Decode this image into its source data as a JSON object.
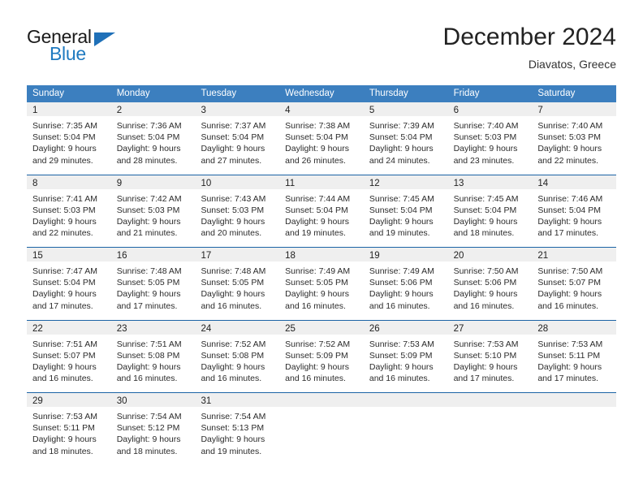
{
  "brand": {
    "name_part1": "General",
    "name_part2": "Blue",
    "triangle_color": "#1f70b8",
    "blue_color": "#1f7ac0"
  },
  "header": {
    "month_title": "December 2024",
    "location": "Diavatos, Greece"
  },
  "colors": {
    "header_band": "#3c7fbf",
    "row_divider": "#1b63a5",
    "day_number_band": "#efefef",
    "text": "#2b2b2b"
  },
  "weekdays": [
    "Sunday",
    "Monday",
    "Tuesday",
    "Wednesday",
    "Thursday",
    "Friday",
    "Saturday"
  ],
  "weeks": [
    [
      {
        "day": "1",
        "sunrise": "Sunrise: 7:35 AM",
        "sunset": "Sunset: 5:04 PM",
        "daylight1": "Daylight: 9 hours",
        "daylight2": "and 29 minutes."
      },
      {
        "day": "2",
        "sunrise": "Sunrise: 7:36 AM",
        "sunset": "Sunset: 5:04 PM",
        "daylight1": "Daylight: 9 hours",
        "daylight2": "and 28 minutes."
      },
      {
        "day": "3",
        "sunrise": "Sunrise: 7:37 AM",
        "sunset": "Sunset: 5:04 PM",
        "daylight1": "Daylight: 9 hours",
        "daylight2": "and 27 minutes."
      },
      {
        "day": "4",
        "sunrise": "Sunrise: 7:38 AM",
        "sunset": "Sunset: 5:04 PM",
        "daylight1": "Daylight: 9 hours",
        "daylight2": "and 26 minutes."
      },
      {
        "day": "5",
        "sunrise": "Sunrise: 7:39 AM",
        "sunset": "Sunset: 5:04 PM",
        "daylight1": "Daylight: 9 hours",
        "daylight2": "and 24 minutes."
      },
      {
        "day": "6",
        "sunrise": "Sunrise: 7:40 AM",
        "sunset": "Sunset: 5:03 PM",
        "daylight1": "Daylight: 9 hours",
        "daylight2": "and 23 minutes."
      },
      {
        "day": "7",
        "sunrise": "Sunrise: 7:40 AM",
        "sunset": "Sunset: 5:03 PM",
        "daylight1": "Daylight: 9 hours",
        "daylight2": "and 22 minutes."
      }
    ],
    [
      {
        "day": "8",
        "sunrise": "Sunrise: 7:41 AM",
        "sunset": "Sunset: 5:03 PM",
        "daylight1": "Daylight: 9 hours",
        "daylight2": "and 22 minutes."
      },
      {
        "day": "9",
        "sunrise": "Sunrise: 7:42 AM",
        "sunset": "Sunset: 5:03 PM",
        "daylight1": "Daylight: 9 hours",
        "daylight2": "and 21 minutes."
      },
      {
        "day": "10",
        "sunrise": "Sunrise: 7:43 AM",
        "sunset": "Sunset: 5:03 PM",
        "daylight1": "Daylight: 9 hours",
        "daylight2": "and 20 minutes."
      },
      {
        "day": "11",
        "sunrise": "Sunrise: 7:44 AM",
        "sunset": "Sunset: 5:04 PM",
        "daylight1": "Daylight: 9 hours",
        "daylight2": "and 19 minutes."
      },
      {
        "day": "12",
        "sunrise": "Sunrise: 7:45 AM",
        "sunset": "Sunset: 5:04 PM",
        "daylight1": "Daylight: 9 hours",
        "daylight2": "and 19 minutes."
      },
      {
        "day": "13",
        "sunrise": "Sunrise: 7:45 AM",
        "sunset": "Sunset: 5:04 PM",
        "daylight1": "Daylight: 9 hours",
        "daylight2": "and 18 minutes."
      },
      {
        "day": "14",
        "sunrise": "Sunrise: 7:46 AM",
        "sunset": "Sunset: 5:04 PM",
        "daylight1": "Daylight: 9 hours",
        "daylight2": "and 17 minutes."
      }
    ],
    [
      {
        "day": "15",
        "sunrise": "Sunrise: 7:47 AM",
        "sunset": "Sunset: 5:04 PM",
        "daylight1": "Daylight: 9 hours",
        "daylight2": "and 17 minutes."
      },
      {
        "day": "16",
        "sunrise": "Sunrise: 7:48 AM",
        "sunset": "Sunset: 5:05 PM",
        "daylight1": "Daylight: 9 hours",
        "daylight2": "and 17 minutes."
      },
      {
        "day": "17",
        "sunrise": "Sunrise: 7:48 AM",
        "sunset": "Sunset: 5:05 PM",
        "daylight1": "Daylight: 9 hours",
        "daylight2": "and 16 minutes."
      },
      {
        "day": "18",
        "sunrise": "Sunrise: 7:49 AM",
        "sunset": "Sunset: 5:05 PM",
        "daylight1": "Daylight: 9 hours",
        "daylight2": "and 16 minutes."
      },
      {
        "day": "19",
        "sunrise": "Sunrise: 7:49 AM",
        "sunset": "Sunset: 5:06 PM",
        "daylight1": "Daylight: 9 hours",
        "daylight2": "and 16 minutes."
      },
      {
        "day": "20",
        "sunrise": "Sunrise: 7:50 AM",
        "sunset": "Sunset: 5:06 PM",
        "daylight1": "Daylight: 9 hours",
        "daylight2": "and 16 minutes."
      },
      {
        "day": "21",
        "sunrise": "Sunrise: 7:50 AM",
        "sunset": "Sunset: 5:07 PM",
        "daylight1": "Daylight: 9 hours",
        "daylight2": "and 16 minutes."
      }
    ],
    [
      {
        "day": "22",
        "sunrise": "Sunrise: 7:51 AM",
        "sunset": "Sunset: 5:07 PM",
        "daylight1": "Daylight: 9 hours",
        "daylight2": "and 16 minutes."
      },
      {
        "day": "23",
        "sunrise": "Sunrise: 7:51 AM",
        "sunset": "Sunset: 5:08 PM",
        "daylight1": "Daylight: 9 hours",
        "daylight2": "and 16 minutes."
      },
      {
        "day": "24",
        "sunrise": "Sunrise: 7:52 AM",
        "sunset": "Sunset: 5:08 PM",
        "daylight1": "Daylight: 9 hours",
        "daylight2": "and 16 minutes."
      },
      {
        "day": "25",
        "sunrise": "Sunrise: 7:52 AM",
        "sunset": "Sunset: 5:09 PM",
        "daylight1": "Daylight: 9 hours",
        "daylight2": "and 16 minutes."
      },
      {
        "day": "26",
        "sunrise": "Sunrise: 7:53 AM",
        "sunset": "Sunset: 5:09 PM",
        "daylight1": "Daylight: 9 hours",
        "daylight2": "and 16 minutes."
      },
      {
        "day": "27",
        "sunrise": "Sunrise: 7:53 AM",
        "sunset": "Sunset: 5:10 PM",
        "daylight1": "Daylight: 9 hours",
        "daylight2": "and 17 minutes."
      },
      {
        "day": "28",
        "sunrise": "Sunrise: 7:53 AM",
        "sunset": "Sunset: 5:11 PM",
        "daylight1": "Daylight: 9 hours",
        "daylight2": "and 17 minutes."
      }
    ],
    [
      {
        "day": "29",
        "sunrise": "Sunrise: 7:53 AM",
        "sunset": "Sunset: 5:11 PM",
        "daylight1": "Daylight: 9 hours",
        "daylight2": "and 18 minutes."
      },
      {
        "day": "30",
        "sunrise": "Sunrise: 7:54 AM",
        "sunset": "Sunset: 5:12 PM",
        "daylight1": "Daylight: 9 hours",
        "daylight2": "and 18 minutes."
      },
      {
        "day": "31",
        "sunrise": "Sunrise: 7:54 AM",
        "sunset": "Sunset: 5:13 PM",
        "daylight1": "Daylight: 9 hours",
        "daylight2": "and 19 minutes."
      },
      {
        "day": "",
        "sunrise": "",
        "sunset": "",
        "daylight1": "",
        "daylight2": ""
      },
      {
        "day": "",
        "sunrise": "",
        "sunset": "",
        "daylight1": "",
        "daylight2": ""
      },
      {
        "day": "",
        "sunrise": "",
        "sunset": "",
        "daylight1": "",
        "daylight2": ""
      },
      {
        "day": "",
        "sunrise": "",
        "sunset": "",
        "daylight1": "",
        "daylight2": ""
      }
    ]
  ]
}
